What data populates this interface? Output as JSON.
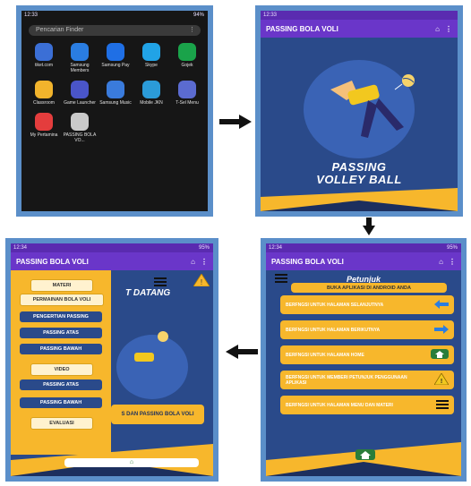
{
  "screens": {
    "launcher": {
      "status_time": "12:33",
      "status_right": "94%",
      "search_placeholder": "Pencarian Finder",
      "apps": [
        {
          "label": "tiket.com",
          "color": "#3b6fd6"
        },
        {
          "label": "Samsung Members",
          "color": "#2a7de1"
        },
        {
          "label": "Samsung Pay",
          "color": "#1f6fe5"
        },
        {
          "label": "Skype",
          "color": "#21a3e6"
        },
        {
          "label": "Gojek",
          "color": "#1aa34a"
        },
        {
          "label": "Classroom",
          "color": "#f2b42c"
        },
        {
          "label": "Game Launcher",
          "color": "#4a55c9"
        },
        {
          "label": "Samsung Music",
          "color": "#3a7bdc"
        },
        {
          "label": "Mobile JKN",
          "color": "#2b9bd8"
        },
        {
          "label": "T-Sel Menu",
          "color": "#5b6bd0"
        },
        {
          "label": "My Pertamina",
          "color": "#e43d3d"
        },
        {
          "label": "PASSING BOLA VO...",
          "color": "#c9c9c9"
        }
      ]
    },
    "splash": {
      "status_time": "12:33",
      "app_title": "PASSING BOLA VOLI",
      "big_title_line1": "PASSING",
      "big_title_line2": "VOLLEY BALL"
    },
    "drawer": {
      "status_time": "12:34",
      "status_right": "95%",
      "app_title": "PASSING BOLA VOLI",
      "bg_text": "T DATANG",
      "bg_banner": "S DAN PASSING BOLA VOLI",
      "items": [
        "MATERI",
        "PERMAINAN BOLA VOLI",
        "PENGERTIAN PASSING",
        "PASSING ATAS",
        "PASSING BAWAH",
        "VIDEO",
        "PASSING ATAS",
        "PASSING BAWAH",
        "EVALUASI"
      ]
    },
    "petunjuk": {
      "status_time": "12:34",
      "status_right": "95%",
      "app_title": "PASSING BOLA VOLI",
      "title": "Petunjuk",
      "top_button": "BUKA APLIKASI DI ANDROID ANDA",
      "rows": [
        {
          "text": "BERFNGSI UNTUK HALAMAN SELANJUTNYA",
          "icon": "arrow-left-icon"
        },
        {
          "text": "BERFNGSI UNTUK HALAMAN BERIKUTNYA",
          "icon": "arrow-right-icon"
        },
        {
          "text": "BERFNGSI UNTUK HALAMAN HOME",
          "icon": "home-icon"
        },
        {
          "text": "BERFNGSI UNTUK MEMBERI PETUNJUK PENGGUNAAN APLIKASI",
          "icon": "warning-icon"
        },
        {
          "text": "BERFNGSI UNTUK HALAMAN MENU DAN MATERI",
          "icon": "menu-icon"
        }
      ]
    }
  },
  "colors": {
    "purple": "#6a36c9",
    "navy": "#2a4a8a",
    "amber": "#f7b72c",
    "frame": "#5b8fc9"
  }
}
